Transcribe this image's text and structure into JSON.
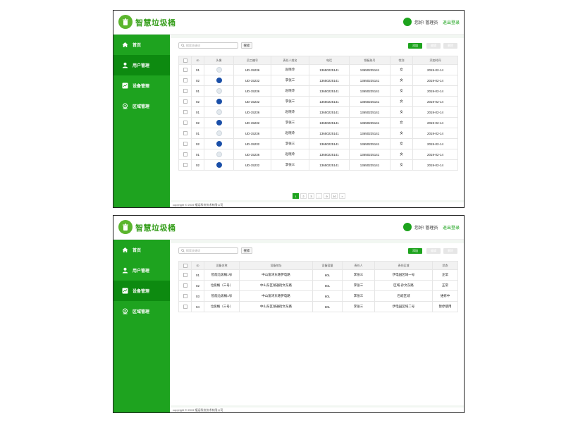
{
  "app": {
    "title": "智慧垃圾桶",
    "greeting": "您好! 管理员",
    "logout": "退出登录",
    "copyright": "copyright © 2019 福运科技技术有限公司"
  },
  "nav": {
    "home": "首页",
    "users": "用户管理",
    "devices": "设备管理",
    "regions": "区域管理"
  },
  "toolbar": {
    "search_placeholder": "搜索关键词",
    "search_btn": "搜索",
    "add": "添加",
    "edit": "编辑",
    "delete": "删除"
  },
  "users_table": {
    "headers": [
      "",
      "ID",
      "头像",
      "员工编号",
      "责任人姓名",
      "电话",
      "钢板账号",
      "性别",
      "添加时间"
    ],
    "rows": [
      {
        "id": "01",
        "avatar": "light",
        "emp": "UD-15236",
        "name": "赵晓玲",
        "phone": "13650225141",
        "acct": "13650225141",
        "gender": "女",
        "date": "2019-02-14"
      },
      {
        "id": "02",
        "avatar": "blue",
        "emp": "UD-15232",
        "name": "李张三",
        "phone": "13650225141",
        "acct": "13650225141",
        "gender": "女",
        "date": "2019-02-14"
      },
      {
        "id": "01",
        "avatar": "light",
        "emp": "UD-15236",
        "name": "赵晓玲",
        "phone": "13650225141",
        "acct": "13650225141",
        "gender": "女",
        "date": "2019-02-14"
      },
      {
        "id": "02",
        "avatar": "blue",
        "emp": "UD-15232",
        "name": "李张三",
        "phone": "13650225141",
        "acct": "13650225141",
        "gender": "女",
        "date": "2019-02-14"
      },
      {
        "id": "01",
        "avatar": "light",
        "emp": "UD-15236",
        "name": "赵晓玲",
        "phone": "13650225141",
        "acct": "13650225141",
        "gender": "女",
        "date": "2019-02-14"
      },
      {
        "id": "02",
        "avatar": "blue",
        "emp": "UD-15232",
        "name": "李张三",
        "phone": "13650225141",
        "acct": "13650225141",
        "gender": "女",
        "date": "2019-02-14"
      },
      {
        "id": "01",
        "avatar": "light",
        "emp": "UD-15236",
        "name": "赵晓玲",
        "phone": "13650225141",
        "acct": "13650225141",
        "gender": "女",
        "date": "2019-02-14"
      },
      {
        "id": "02",
        "avatar": "blue",
        "emp": "UD-15232",
        "name": "李张三",
        "phone": "13650225141",
        "acct": "13650225141",
        "gender": "女",
        "date": "2019-02-14"
      },
      {
        "id": "01",
        "avatar": "light",
        "emp": "UD-15236",
        "name": "赵晓玲",
        "phone": "13650225141",
        "acct": "13650225141",
        "gender": "女",
        "date": "2019-02-14"
      },
      {
        "id": "02",
        "avatar": "blue",
        "emp": "UD-15232",
        "name": "李张三",
        "phone": "13650225141",
        "acct": "13650225141",
        "gender": "女",
        "date": "2019-02-14"
      }
    ]
  },
  "pagination": {
    "pages": [
      "1",
      "2",
      "3",
      "...",
      "9",
      "10",
      ">"
    ],
    "current": "1"
  },
  "devices_table": {
    "headers": [
      "",
      "ID",
      "设备名称",
      "设备地址",
      "设备容量",
      "责任人",
      "责任区域",
      "状态"
    ],
    "rows": [
      {
        "id": "01",
        "name": "智能垃圾桶1号",
        "addr": "中山富湾东路伊电路",
        "cap": "60L",
        "owner": "李张三",
        "area": "伊电园区域一号",
        "status": "正常",
        "status_class": "st-normal"
      },
      {
        "id": "02",
        "name": "垃圾桶（三号）",
        "addr": "中山东区湖通街文东路",
        "cap": "60L",
        "owner": "李张三",
        "area": "区域-孙文东路",
        "status": "正常",
        "status_class": "st-normal"
      },
      {
        "id": "03",
        "name": "智能垃圾桶1号",
        "addr": "中山富湾东路伊电路",
        "cap": "60L",
        "owner": "李张三",
        "area": "石岐区域",
        "status": "维修中",
        "status_class": "st-repair"
      },
      {
        "id": "04",
        "name": "垃圾桶（三号）",
        "addr": "中山东区湖通街文东路",
        "cap": "60L",
        "owner": "李张三",
        "area": "伊电园区域二号",
        "status": "暂停使用",
        "status_class": "st-stop"
      }
    ]
  },
  "colors": {
    "brand": "#1ea31f",
    "brand_dark": "#0d8a10",
    "repair": "#2a7de1",
    "stop": "#e02020"
  }
}
